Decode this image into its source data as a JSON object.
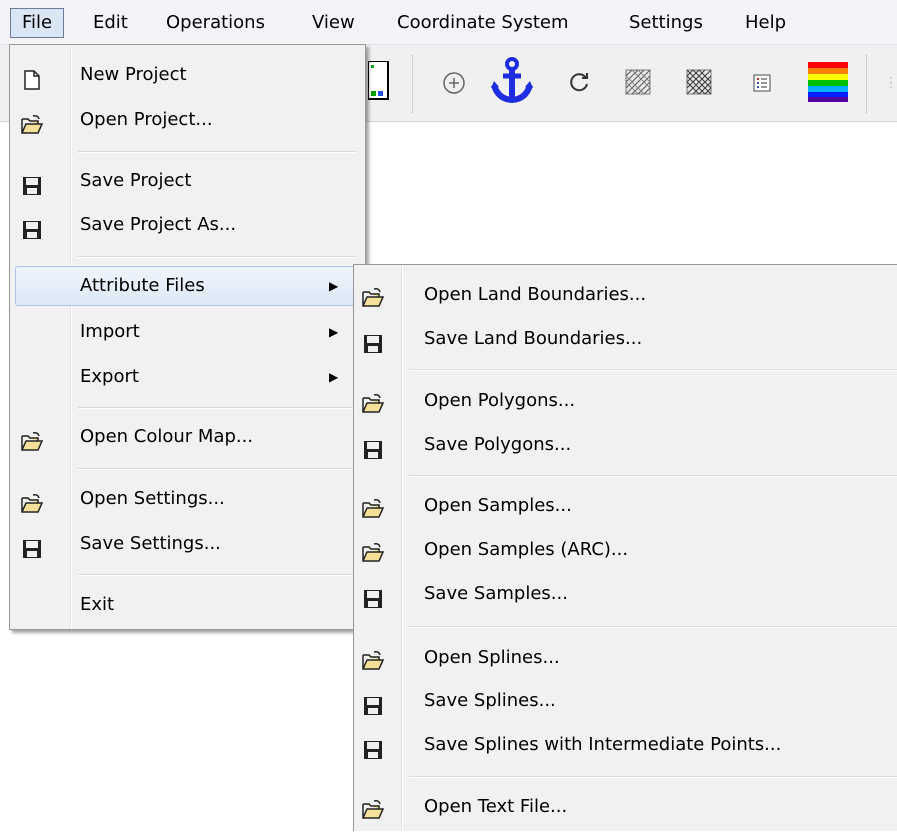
{
  "menubar": {
    "items": [
      "File",
      "Edit",
      "Operations",
      "View",
      "Coordinate System",
      "Settings",
      "Help"
    ]
  },
  "file_menu": {
    "new_project": "New Project",
    "open_project": "Open Project...",
    "save_project": "Save Project",
    "save_project_as": "Save Project As...",
    "attribute_files": "Attribute Files",
    "import": "Import",
    "export": "Export",
    "open_colour_map": "Open Colour Map...",
    "open_settings": "Open Settings...",
    "save_settings": "Save Settings...",
    "exit": "Exit"
  },
  "attribute_menu": {
    "open_land_boundaries": "Open Land Boundaries...",
    "save_land_boundaries": "Save Land Boundaries...",
    "open_polygons": "Open Polygons...",
    "save_polygons": "Save Polygons...",
    "open_samples": "Open Samples...",
    "open_samples_arc": "Open Samples (ARC)...",
    "save_samples": "Save Samples...",
    "open_splines": "Open Splines...",
    "save_splines": "Save Splines...",
    "save_splines_intermediate": "Save Splines with Intermediate Points...",
    "open_text_file": "Open Text File..."
  },
  "colors": {
    "anchor": "#1f2de0",
    "highlight_border": "#a9c4e6",
    "menu_bg": "#f1f1f1"
  }
}
